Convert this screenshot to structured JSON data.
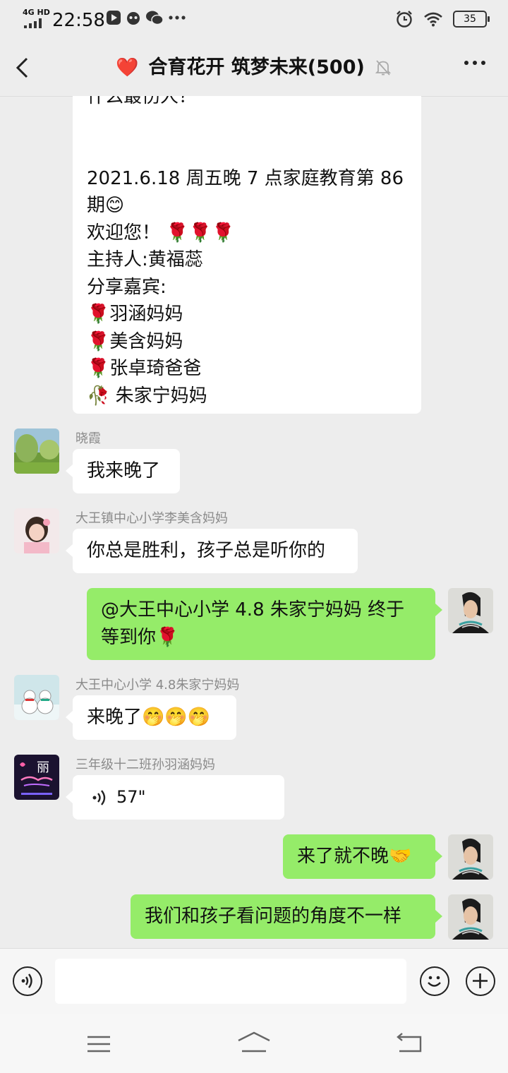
{
  "status_bar": {
    "network": "4G HD",
    "time": "22:58",
    "battery": "35"
  },
  "header": {
    "title_emoji": "❤️",
    "title": "合育花开 筑梦未来(500)"
  },
  "messages": {
    "long": {
      "partial_top": "什么最伤人？",
      "line1": "2021.6.18 周五晚 7 点家庭教育第 86",
      "line2": "期😊",
      "line3": "欢迎您！ 🌹🌹🌹",
      "line4": "主持人:黄福蕊",
      "line5": "分享嘉宾:",
      "line6": "🌹羽涵妈妈",
      "line7": "🌹美含妈妈",
      "line8": "🌹张卓琦爸爸",
      "line9": "🥀 朱家宁妈妈"
    },
    "m1": {
      "sender": "晓霞",
      "text": "我来晚了"
    },
    "m2": {
      "sender": "大王镇中心小学李美含妈妈",
      "text": "你总是胜利，孩子总是听你的"
    },
    "m3": {
      "line1": "@大王中心小学 4.8 朱家宁妈妈  终于",
      "line2": "等到你🌹"
    },
    "m4": {
      "sender": "大王中心小学 4.8朱家宁妈妈",
      "text": "来晚了🤭🤭🤭"
    },
    "m5": {
      "sender": "三年级十二班孙羽涵妈妈",
      "voice": "57\""
    },
    "m6": {
      "text": "来了就不晚🤝"
    },
    "m7": {
      "text": "我们和孩子看问题的角度不一样"
    }
  },
  "avatar_text": {
    "m5_char": "丽"
  },
  "colors": {
    "background": "#ededed",
    "bubble_self": "#95ec69",
    "bubble_other": "#ffffff",
    "sender_gray": "#8a8a8a"
  },
  "icons": [
    "back-arrow-icon",
    "mute-bell-icon",
    "more-icon",
    "voice-icon",
    "emoji-icon",
    "plus-icon",
    "menu-icon",
    "home-icon",
    "back-nav-icon"
  ]
}
